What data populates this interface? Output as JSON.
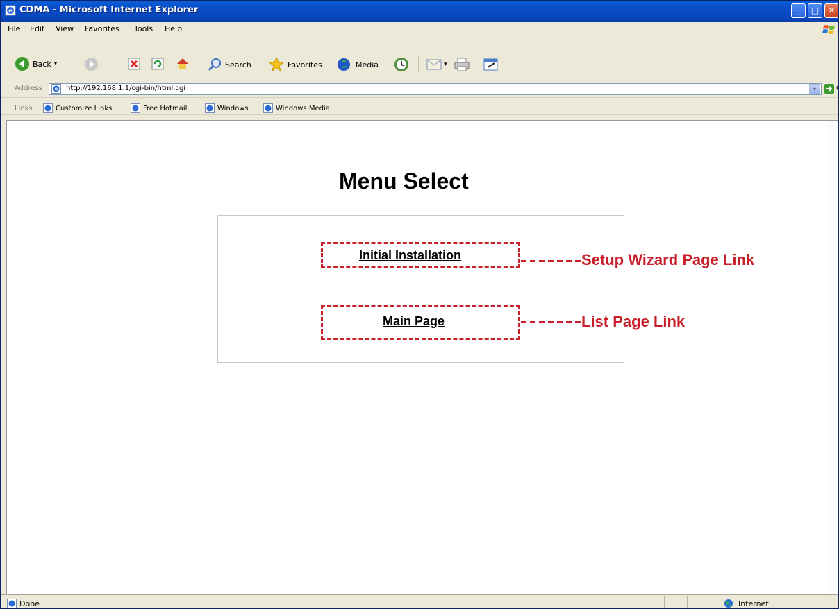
{
  "window": {
    "title": "CDMA - Microsoft Internet Explorer",
    "controls": {
      "minimize": "_",
      "maximize": "□",
      "close": "✕"
    }
  },
  "menu": [
    "File",
    "Edit",
    "View",
    "Favorites",
    "Tools",
    "Help"
  ],
  "toolbar": {
    "back": "Back",
    "search": "Search",
    "favorites": "Favorites",
    "media": "Media",
    "dropdown_glyph": "▾"
  },
  "address": {
    "label": "Address",
    "url": "http://192.168.1.1/cgi-bin/html.cgi",
    "dropdown_glyph": "▾",
    "go": "Go"
  },
  "links": {
    "label": "Links",
    "items": [
      "Customize Links",
      "Free Hotmail",
      "Windows",
      "Windows Media"
    ]
  },
  "page": {
    "heading": "Menu Select",
    "initial_installation": "Initial Installation",
    "main_page": "Main Page"
  },
  "callouts": {
    "setup_wizard": "Setup Wizard Page Link",
    "list_page": "List Page Link"
  },
  "status": {
    "text": "Done",
    "zone": "Internet"
  },
  "colors": {
    "titlebar": "#0a4bc7",
    "chrome": "#ece9d8",
    "callout_red": "#c8202b"
  },
  "icons": [
    "ie-page-icon",
    "back-arrow-icon",
    "forward-arrow-icon",
    "stop-icon",
    "refresh-icon",
    "home-icon",
    "search-icon",
    "favorites-star-icon",
    "media-icon",
    "history-icon",
    "mail-icon",
    "print-icon",
    "edit-icon",
    "go-arrow-icon",
    "globe-icon",
    "windows-logo-icon"
  ]
}
